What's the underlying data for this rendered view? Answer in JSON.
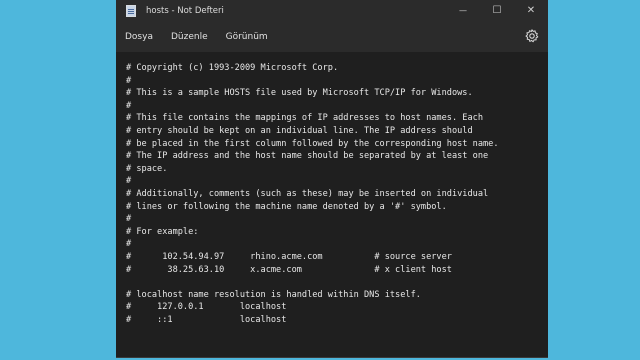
{
  "window": {
    "title": "hosts - Not Defteri"
  },
  "controls": {
    "minimize": "—",
    "maximize": "☐",
    "close": "✕"
  },
  "menu": {
    "file": "Dosya",
    "edit": "Düzenle",
    "view": "Görünüm"
  },
  "icons": {
    "app": "notepad-icon",
    "settings": "gear-icon"
  },
  "editor": {
    "lines": [
      "# Copyright (c) 1993-2009 Microsoft Corp.",
      "#",
      "# This is a sample HOSTS file used by Microsoft TCP/IP for Windows.",
      "#",
      "# This file contains the mappings of IP addresses to host names. Each",
      "# entry should be kept on an individual line. The IP address should",
      "# be placed in the first column followed by the corresponding host name.",
      "# The IP address and the host name should be separated by at least one",
      "# space.",
      "#",
      "# Additionally, comments (such as these) may be inserted on individual",
      "# lines or following the machine name denoted by a '#' symbol.",
      "#",
      "# For example:",
      "#",
      "#      102.54.94.97     rhino.acme.com          # source server",
      "#       38.25.63.10     x.acme.com              # x client host",
      "",
      "# localhost name resolution is handled within DNS itself.",
      "#     127.0.0.1       localhost",
      "#     ::1             localhost"
    ]
  }
}
